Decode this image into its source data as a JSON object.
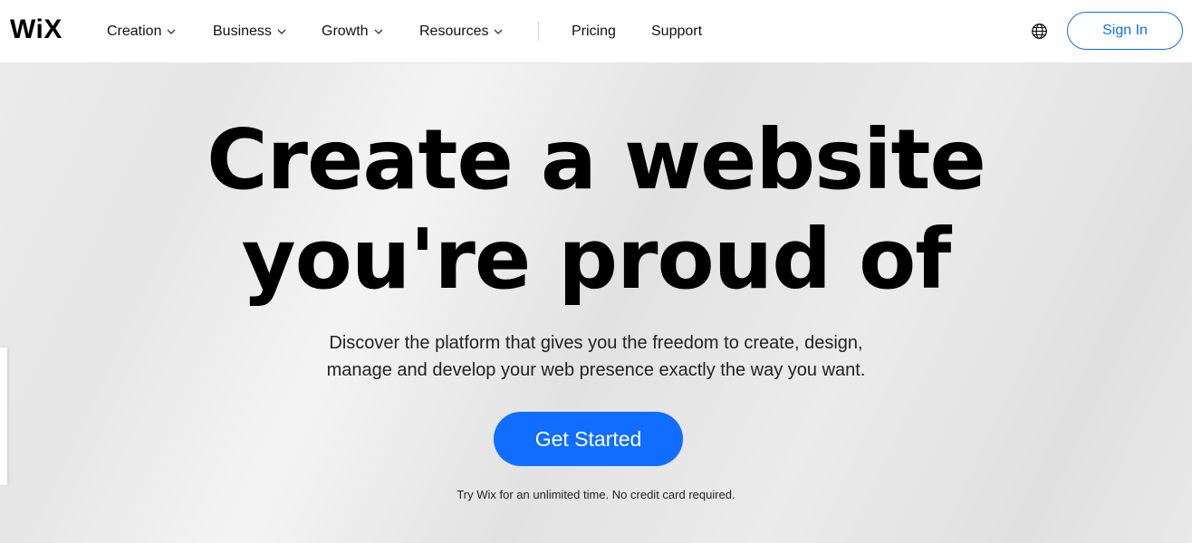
{
  "brand": {
    "logo_text": "WiX"
  },
  "nav": {
    "items": [
      {
        "label": "Creation",
        "has_dropdown": true
      },
      {
        "label": "Business",
        "has_dropdown": true
      },
      {
        "label": "Growth",
        "has_dropdown": true
      },
      {
        "label": "Resources",
        "has_dropdown": true
      },
      {
        "label": "Pricing",
        "has_dropdown": false
      },
      {
        "label": "Support",
        "has_dropdown": false
      }
    ],
    "language_icon": "globe-icon",
    "signin_label": "Sign In"
  },
  "hero": {
    "headline_line1": "Create a website",
    "headline_line2": "you're proud of",
    "subtitle_line1": "Discover the platform that gives you the freedom to create, design,",
    "subtitle_line2": "manage and develop your web presence exactly the way you want.",
    "cta_label": "Get Started",
    "note": "Try Wix for an unlimited time. No credit card required."
  },
  "colors": {
    "accent": "#116dff",
    "text": "#000000",
    "nav_background": "#ffffff"
  }
}
